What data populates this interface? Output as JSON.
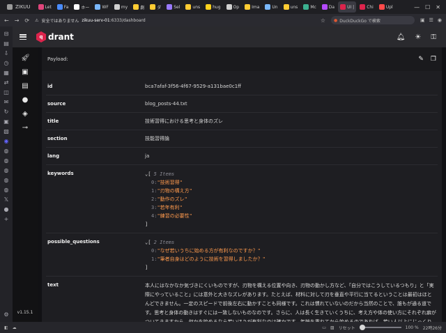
{
  "browser": {
    "tabs": [
      {
        "label": "ZIKUU",
        "color": "#9a9a9a"
      },
      {
        "label": "Let",
        "color": "#e0457b"
      },
      {
        "label": "Fa",
        "color": "#4a8cff"
      },
      {
        "label": "ホー",
        "color": "#ffffff"
      },
      {
        "label": "WF",
        "color": "#7ab8ff"
      },
      {
        "label": "my",
        "color": "#d0d0d0"
      },
      {
        "label": "劇",
        "color": "#ffcc33"
      },
      {
        "label": "ダ",
        "color": "#ffcc33"
      },
      {
        "label": "Sel",
        "color": "#9a7aff"
      },
      {
        "label": "uns",
        "color": "#ffcc33"
      },
      {
        "label": "hug",
        "color": "#ffd21e"
      },
      {
        "label": "Op",
        "color": "#d0d0d0"
      },
      {
        "label": "Ima",
        "color": "#ffcc33"
      },
      {
        "label": "Un",
        "color": "#7ab8ff"
      },
      {
        "label": "uns",
        "color": "#ffcc33"
      },
      {
        "label": "Mc",
        "color": "#3bb08f"
      },
      {
        "label": "Da",
        "color": "#b44aff"
      },
      {
        "label": "UI |",
        "color": "#dc244c"
      },
      {
        "label": "Chi",
        "color": "#dc244c"
      },
      {
        "label": "Upl",
        "color": "#ff4a4a"
      }
    ],
    "active_tab_index": 17,
    "security_label": "安全ではありません",
    "url_host": "zikuu-serv-01",
    "url_rest": ":6333/dashboard",
    "search_placeholder": "DuckDuckGo で検索",
    "status_bar": {
      "reset_label": "リセット",
      "zoom": "100 %",
      "clock": "22時26分"
    }
  },
  "app": {
    "logo_text": "drant",
    "version": "v1.15.1",
    "panel_title": "Payload:"
  },
  "payload": {
    "id_key": "id",
    "id_value": "bca7afaf-3f56-4f67-9529-a131bae0c1ff",
    "source_key": "source",
    "source_value": "blog_posts-44.txt",
    "title_key": "title",
    "title_value": "技術習得における思考と身体のズレ",
    "section_key": "section",
    "section_value": "技能習得論",
    "lang_key": "lang",
    "lang_value": "ja",
    "keywords_key": "keywords",
    "keywords_count_label": "5 Items",
    "keywords": [
      {
        "index": "0:",
        "value": "\"技術習得\""
      },
      {
        "index": "1:",
        "value": "\"刃物の構え方\""
      },
      {
        "index": "2:",
        "value": "\"動作のズレ\""
      },
      {
        "index": "3:",
        "value": "\"若年有利\""
      },
      {
        "index": "4:",
        "value": "\"練習の必要性\""
      }
    ],
    "questions_key": "possible_questions",
    "questions_count_label": "2 Items",
    "questions": [
      {
        "index": "0:",
        "value": "\"なぜ若いうちに始める方が有利なのですか？\""
      },
      {
        "index": "1:",
        "value": "\"筆者自身はどのように技術を習得しましたか？\""
      }
    ],
    "text_key": "text",
    "text_value": "本人にはなかなか気づきにくいものですが、刃物を構える位置や向き、刃物の動かし方など、「自分ではこうしているつもり」と「実際にやっていること」には意外と大きなズレがあります。たとえば、材料に対して刃を垂直や平行に当てるということは最初はほとんどできません。一定のスピードで前後左右に動かすことも同様です。これは慣れていないのだから当然のことで、誰もが通る道です。思考と身体の動きはすぐには一致しないものなのです。さらに、人は長く生きていくうちに、考え方や体の使い方にそれぞれ癖がついてきますから、何かを始めるなら若いほうが有利なのは確かです。年齢を重ねてから始めるのであれば、若い人以上にじっくり時間をかけて取り組む覚悟が必要になります。実を言えば、"
  }
}
